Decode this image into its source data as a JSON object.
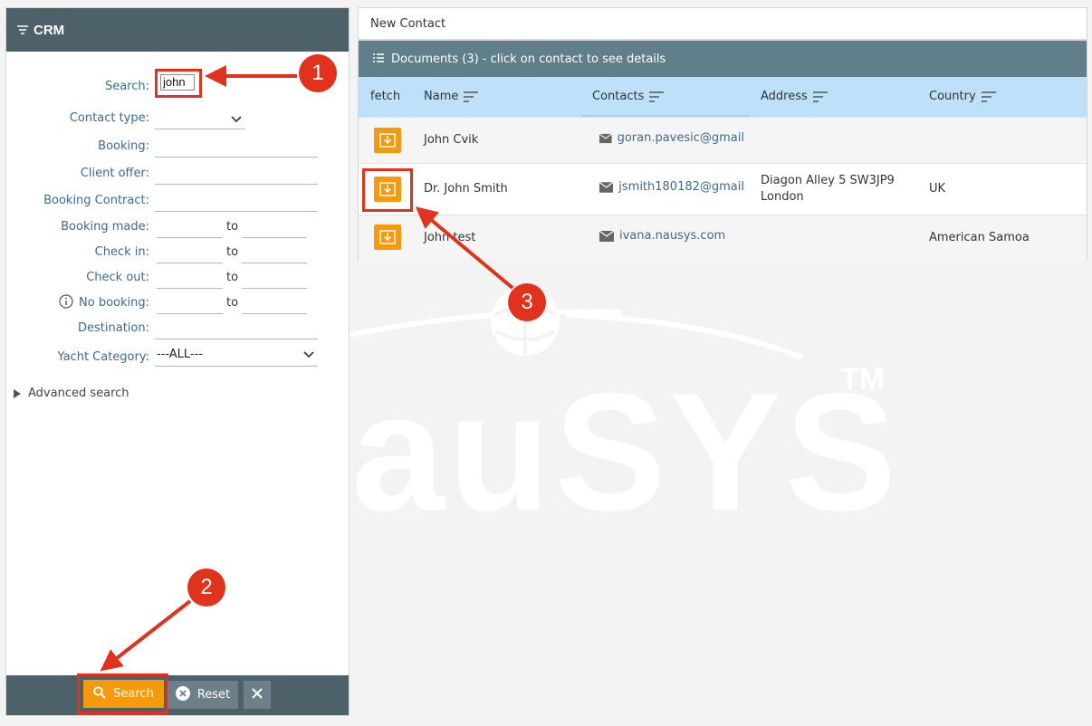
{
  "sidebar": {
    "title": "CRM",
    "fields": {
      "search_label": "Search:",
      "search_value": "john",
      "contact_type_label": "Contact type:",
      "booking_label": "Booking:",
      "client_offer_label": "Client offer:",
      "booking_contract_label": "Booking Contract:",
      "booking_made_label": "Booking made:",
      "check_in_label": "Check in:",
      "check_out_label": "Check out:",
      "no_booking_label": "No booking:",
      "destination_label": "Destination:",
      "yacht_category_label": "Yacht Category:",
      "yacht_category_value": "---ALL---",
      "to": "to"
    },
    "advanced_search": "Advanced search",
    "buttons": {
      "search": "Search",
      "reset": "Reset"
    }
  },
  "main": {
    "new_contact": "New Contact",
    "documents_header": "Documents (3) - click on contact to see details",
    "columns": [
      "fetch",
      "Name",
      "Contacts",
      "Address",
      "Country"
    ],
    "rows": [
      {
        "name": "John Cvik",
        "contact": "goran.pavesic@gmail",
        "address_line1": "",
        "address_line2": "",
        "country": ""
      },
      {
        "name": "Dr. John Smith",
        "contact": "jsmith180182@gmail",
        "address_line1": "Diagon Alley 5 SW3JP9",
        "address_line2": "London",
        "country": "UK"
      },
      {
        "name": "John test",
        "contact": "ivana.nausys.com",
        "address_line1": "",
        "address_line2": "",
        "country": "American Samoa"
      }
    ]
  },
  "annotations": {
    "badge1": "1",
    "badge2": "2",
    "badge3": "3"
  },
  "watermark": {
    "text": "auSYS",
    "tm": "TM"
  },
  "colors": {
    "header": "#4c6169",
    "table_header": "#617f8b",
    "accent": "#f59a0d",
    "annotation": "#e0321c",
    "column_bg": "#bee0f8",
    "label": "#3c6a93"
  }
}
